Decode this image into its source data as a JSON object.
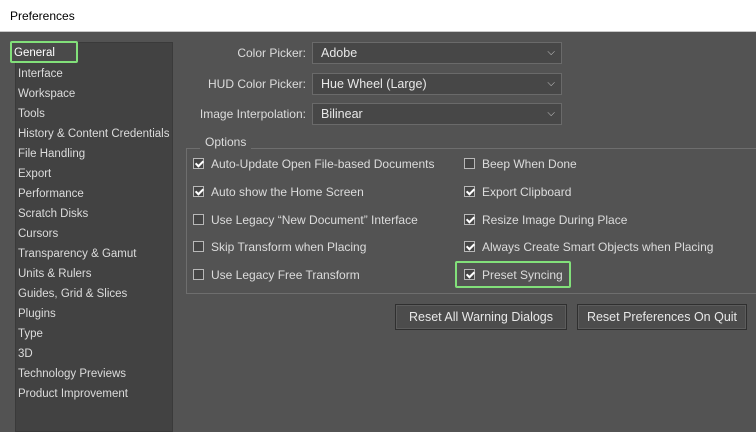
{
  "window": {
    "title": "Preferences"
  },
  "sidebar": {
    "items": [
      {
        "label": "General",
        "selected": true
      },
      {
        "label": "Interface"
      },
      {
        "label": "Workspace"
      },
      {
        "label": "Tools"
      },
      {
        "label": "History & Content Credentials"
      },
      {
        "label": "File Handling"
      },
      {
        "label": "Export"
      },
      {
        "label": "Performance"
      },
      {
        "label": "Scratch Disks"
      },
      {
        "label": "Cursors"
      },
      {
        "label": "Transparency & Gamut"
      },
      {
        "label": "Units & Rulers"
      },
      {
        "label": "Guides, Grid & Slices"
      },
      {
        "label": "Plugins"
      },
      {
        "label": "Type"
      },
      {
        "label": "3D"
      },
      {
        "label": "Technology Previews"
      },
      {
        "label": "Product Improvement"
      }
    ]
  },
  "general": {
    "color_picker": {
      "label": "Color Picker:",
      "value": "Adobe"
    },
    "hud_color_picker": {
      "label": "HUD Color Picker:",
      "value": "Hue Wheel (Large)"
    },
    "image_interpolation": {
      "label": "Image Interpolation:",
      "value": "Bilinear"
    }
  },
  "options": {
    "legend": "Options",
    "left": [
      {
        "label": "Auto-Update Open File-based Documents",
        "checked": true
      },
      {
        "label": "Auto show the Home Screen",
        "checked": true
      },
      {
        "label": "Use Legacy “New Document” Interface",
        "checked": false
      },
      {
        "label": "Skip Transform when Placing",
        "checked": false
      },
      {
        "label": "Use Legacy Free Transform",
        "checked": false
      }
    ],
    "right": [
      {
        "label": "Beep When Done",
        "checked": false
      },
      {
        "label": "Export Clipboard",
        "checked": true
      },
      {
        "label": "Resize Image During Place",
        "checked": true
      },
      {
        "label": "Always Create Smart Objects when Placing",
        "checked": true
      },
      {
        "label": "Preset Syncing",
        "checked": true
      }
    ]
  },
  "buttons": {
    "reset_warnings": "Reset All Warning Dialogs",
    "reset_prefs": "Reset Preferences On Quit"
  },
  "colors": {
    "highlight": "#82e07a",
    "background": "#535353",
    "sidebar_bg": "#424242"
  }
}
